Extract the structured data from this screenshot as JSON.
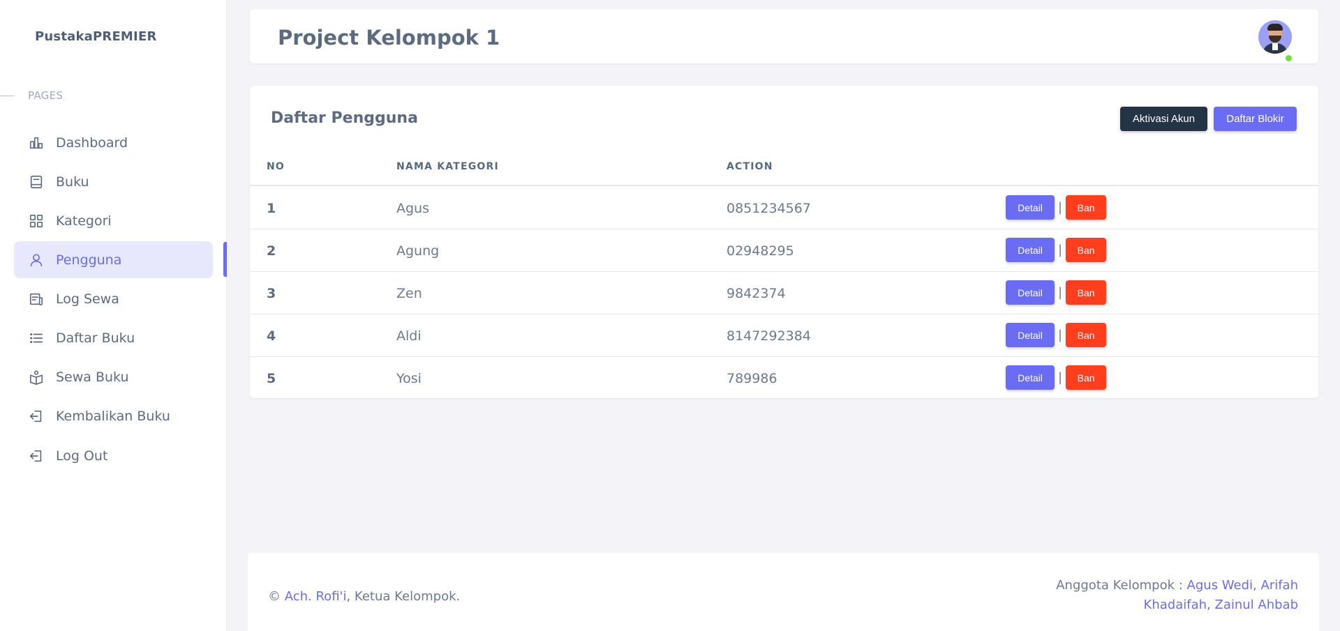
{
  "sidebar": {
    "brand": "PustakaPREMIER",
    "section_label": "PAGES",
    "items": [
      {
        "label": "Dashboard",
        "icon": "bar-chart-icon"
      },
      {
        "label": "Buku",
        "icon": "book-icon"
      },
      {
        "label": "Kategori",
        "icon": "grid-icon"
      },
      {
        "label": "Pengguna",
        "icon": "user-icon",
        "active": true
      },
      {
        "label": "Log Sewa",
        "icon": "receipt-icon"
      },
      {
        "label": "Daftar Buku",
        "icon": "list-icon"
      },
      {
        "label": "Sewa Buku",
        "icon": "book-open-icon"
      },
      {
        "label": "Kembalikan Buku",
        "icon": "log-in-icon"
      },
      {
        "label": "Log Out",
        "icon": "log-out-icon"
      }
    ]
  },
  "header": {
    "title": "Project Kelompok 1",
    "avatar_status": "online"
  },
  "card": {
    "title": "Daftar Pengguna",
    "buttons": {
      "activate": "Aktivasi Akun",
      "blocklist": "Daftar Blokir"
    },
    "columns": [
      "NO",
      "NAMA KATEGORI",
      "ACTION"
    ],
    "rows": [
      {
        "no": "1",
        "name": "Agus",
        "phone": "0851234567"
      },
      {
        "no": "2",
        "name": "Agung",
        "phone": "02948295"
      },
      {
        "no": "3",
        "name": "Zen",
        "phone": "9842374"
      },
      {
        "no": "4",
        "name": "Aldi",
        "phone": "8147292384"
      },
      {
        "no": "5",
        "name": "Yosi",
        "phone": "789986"
      }
    ],
    "row_actions": {
      "detail": "Detail",
      "separator": "|",
      "ban": "Ban"
    }
  },
  "footer": {
    "copyright_symbol": "©",
    "leader_name": "Ach. Rofi'i",
    "leader_suffix": ", Ketua Kelompok.",
    "members_label": "Anggota Kelompok :",
    "members": [
      "Agus Wedi",
      "Arifah Khadaifah",
      "Zainul Ahbab"
    ],
    "members_separator": ", "
  },
  "colors": {
    "primary": "#6a6cf6",
    "dark": "#233446",
    "danger": "#ff3e1d",
    "online": "#71dd37",
    "background": "#f4f4f8"
  }
}
